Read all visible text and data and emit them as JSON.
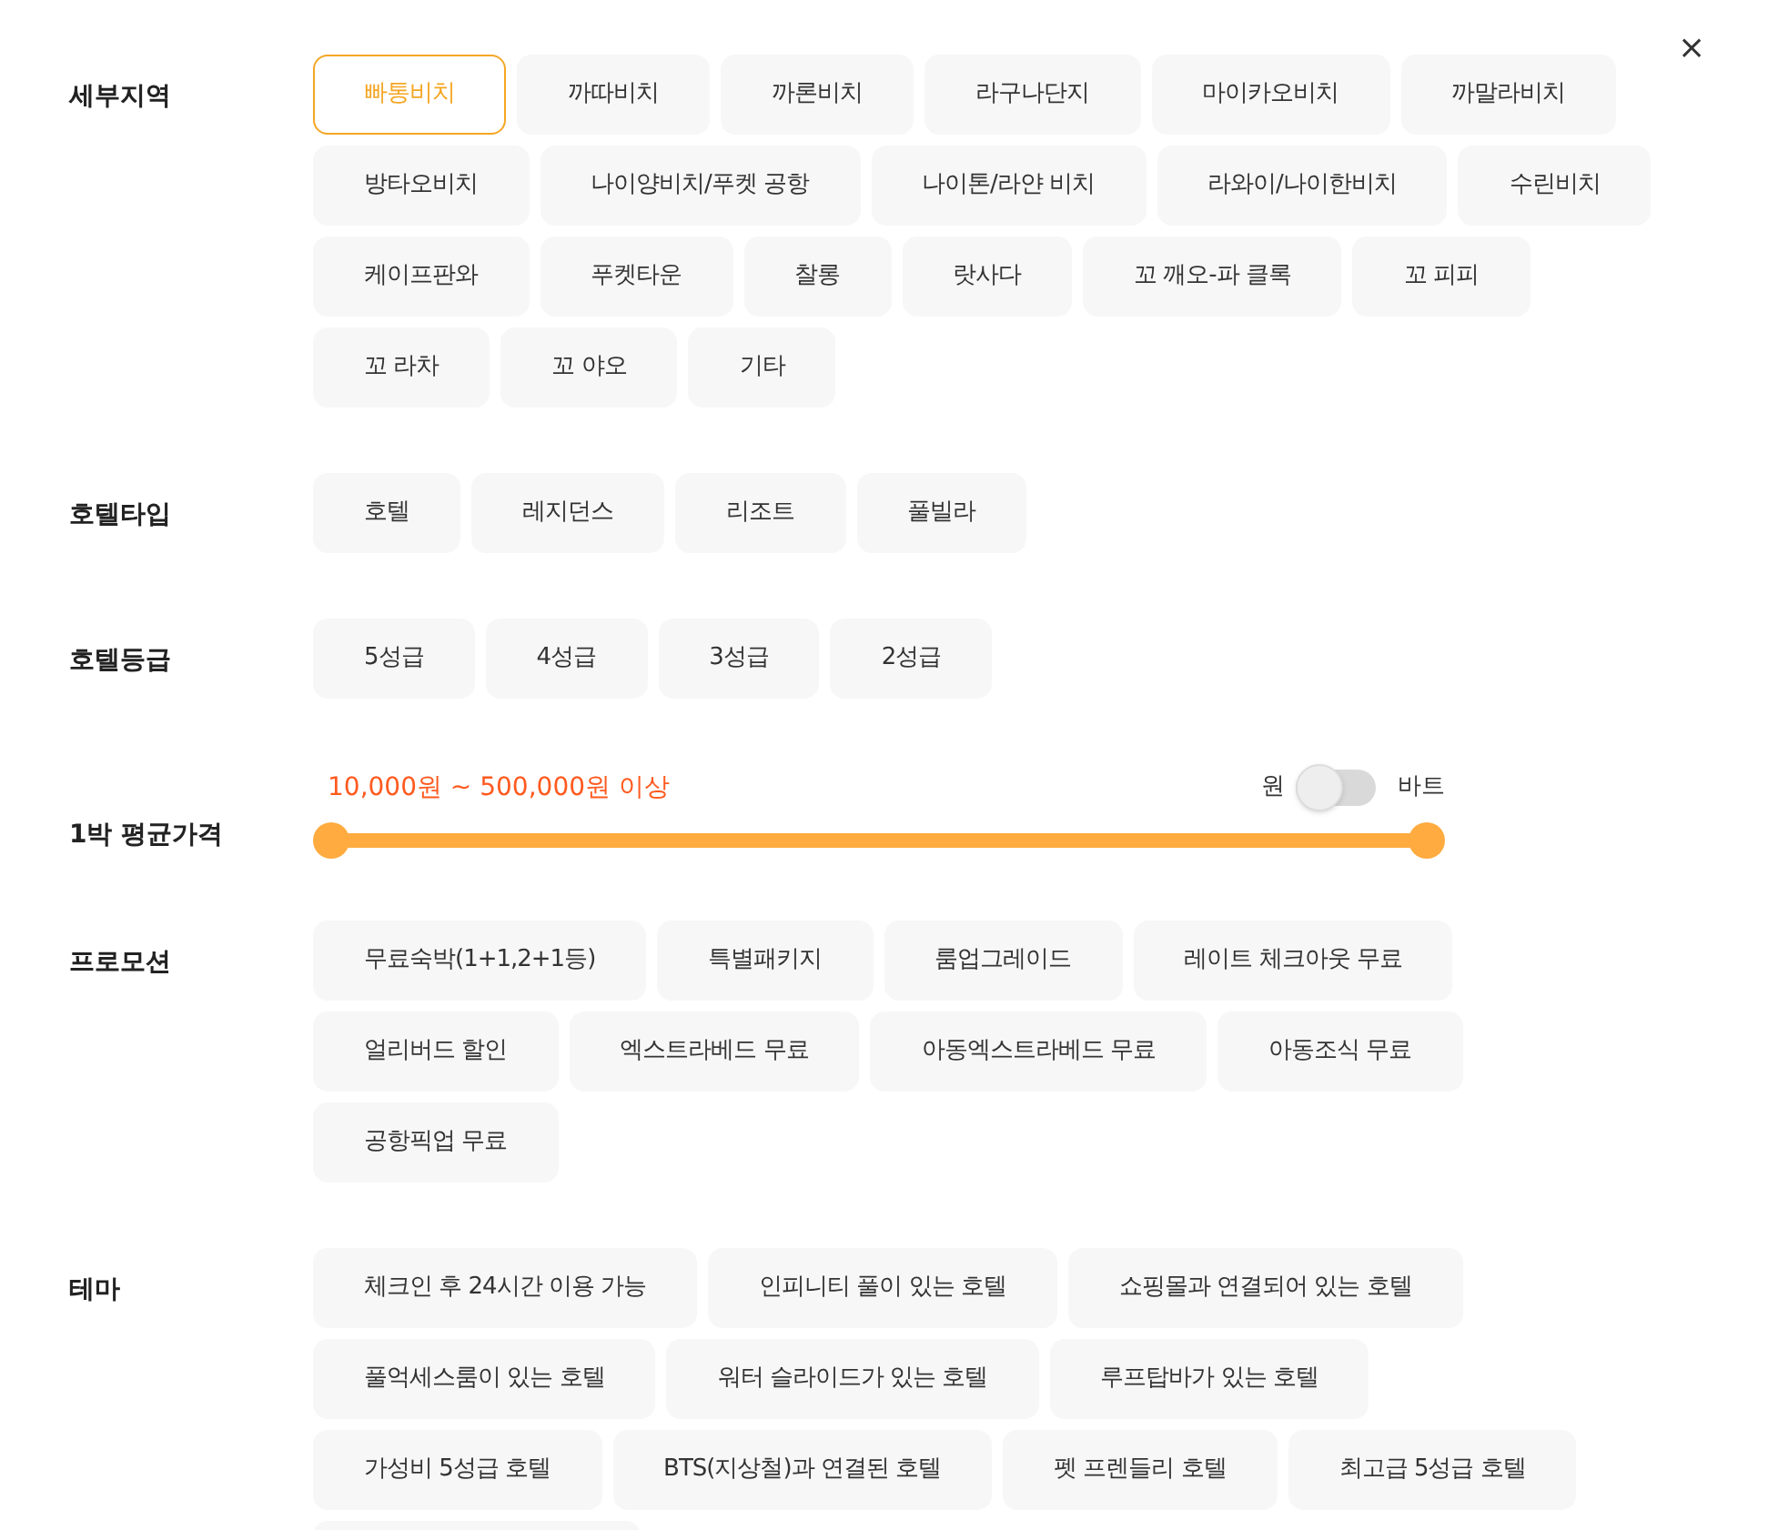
{
  "close_button": {
    "label": "×"
  },
  "sections": [
    {
      "kind": "chips",
      "label": "세부지역",
      "chips": [
        {
          "label": "빠통비치",
          "selected": true
        },
        {
          "label": "까따비치",
          "selected": false
        },
        {
          "label": "까론비치",
          "selected": false
        },
        {
          "label": "라구나단지",
          "selected": false
        },
        {
          "label": "마이카오비치",
          "selected": false
        },
        {
          "label": "까말라비치",
          "selected": false
        },
        {
          "label": "방타오비치",
          "selected": false
        },
        {
          "label": "나이양비치/푸켓 공항",
          "selected": false
        },
        {
          "label": "나이톤/라얀 비치",
          "selected": false
        },
        {
          "label": "라와이/나이한비치",
          "selected": false
        },
        {
          "label": "수린비치",
          "selected": false
        },
        {
          "label": "케이프판와",
          "selected": false
        },
        {
          "label": "푸켓타운",
          "selected": false
        },
        {
          "label": "찰롱",
          "selected": false
        },
        {
          "label": "랏사다",
          "selected": false
        },
        {
          "label": "꼬 깨오-파 클록",
          "selected": false
        },
        {
          "label": "꼬 피피",
          "selected": false
        },
        {
          "label": "꼬 라차",
          "selected": false
        },
        {
          "label": "꼬 야오",
          "selected": false
        },
        {
          "label": "기타",
          "selected": false
        }
      ]
    },
    {
      "kind": "chips",
      "label": "호텔타입",
      "chips": [
        {
          "label": "호텔",
          "selected": false
        },
        {
          "label": "레지던스",
          "selected": false
        },
        {
          "label": "리조트",
          "selected": false
        },
        {
          "label": "풀빌라",
          "selected": false
        }
      ]
    },
    {
      "kind": "chips",
      "label": "호텔등급",
      "chips": [
        {
          "label": "5성급",
          "selected": false
        },
        {
          "label": "4성급",
          "selected": false
        },
        {
          "label": "3성급",
          "selected": false
        },
        {
          "label": "2성급",
          "selected": false
        }
      ]
    },
    {
      "kind": "range",
      "label": "1박 평균가격",
      "reading": "10,000원 ~ 500,000원 이상",
      "handles": [
        {
          "level": 0
        },
        {
          "level": 1
        }
      ],
      "toggle": {
        "left_label": "원",
        "right_label": "바트",
        "on": false
      }
    },
    {
      "kind": "chips",
      "label": "프로모션",
      "chips": [
        {
          "label": "무료숙박(1+1,2+1등)",
          "selected": false
        },
        {
          "label": "특별패키지",
          "selected": false
        },
        {
          "label": "룸업그레이드",
          "selected": false
        },
        {
          "label": "레이트 체크아웃 무료",
          "selected": false
        },
        {
          "label": "얼리버드 할인",
          "selected": false
        },
        {
          "label": "엑스트라베드 무료",
          "selected": false
        },
        {
          "label": "아동엑스트라베드 무료",
          "selected": false
        },
        {
          "label": "아동조식 무료",
          "selected": false
        },
        {
          "label": "공항픽업 무료",
          "selected": false
        }
      ]
    },
    {
      "kind": "chips",
      "label": "테마",
      "chips": [
        {
          "label": "체크인 후 24시간 이용 가능",
          "selected": false
        },
        {
          "label": "인피니티 풀이 있는 호텔",
          "selected": false
        },
        {
          "label": "쇼핑몰과 연결되어 있는 호텔",
          "selected": false
        },
        {
          "label": "풀억세스룸이 있는 호텔",
          "selected": false
        },
        {
          "label": "워터 슬라이드가 있는 호텔",
          "selected": false
        },
        {
          "label": "루프탑바가 있는 호텔",
          "selected": false
        },
        {
          "label": "가성비 5성급 호텔",
          "selected": false
        },
        {
          "label": "BTS(지상철)과 연결된 호텔",
          "selected": false
        },
        {
          "label": "펫 프렌들리 호텔",
          "selected": false
        },
        {
          "label": "최고급 5성급 호텔",
          "selected": false
        },
        {
          "kind": "cut-off",
          "selected": false
        }
      ]
    }
  ]
}
